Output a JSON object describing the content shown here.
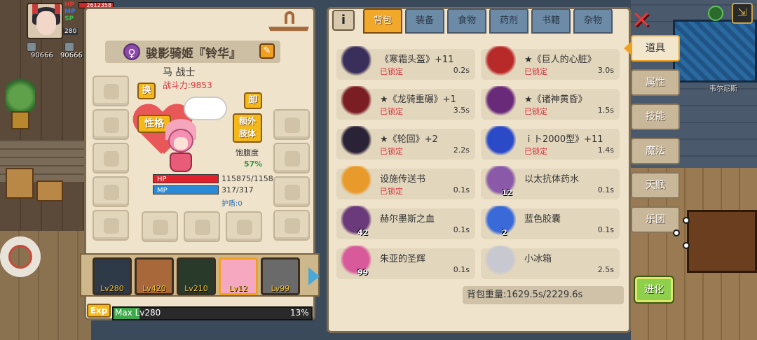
{
  "hud": {
    "hp_label": "HP",
    "mp_label": "MP",
    "sp_label": "SP",
    "hp_value": "2612358",
    "level": "280",
    "money_left": "90666",
    "money_right": "90666"
  },
  "character": {
    "gender_symbol": "♀",
    "name": "骏影骑姬『铃华』",
    "class": "马 战士",
    "power_label": "战斗力:",
    "power_value": "9853",
    "swap_btn": "换",
    "unequip_btn": "卸",
    "personality_btn": "性格",
    "extra_limb_btn": "额外\n肢体",
    "satiety_label": "饱腹度",
    "satiety_value": "57%",
    "hp_label": "HP",
    "hp_value": "115875/1158",
    "hp_fraction": 1.0,
    "mp_label": "MP",
    "mp_value": "317/317",
    "mp_fraction": 1.0,
    "shield": "护盾:0"
  },
  "party": [
    {
      "level": "Lv280",
      "color": "#2e3a48"
    },
    {
      "level": "Lv420",
      "color": "#a8683a"
    },
    {
      "level": "Lv210",
      "color": "#2a3a2a"
    },
    {
      "level": "Lv12",
      "color": "#f6a8c0"
    },
    {
      "level": "Lv99",
      "color": "#6a6a6a"
    }
  ],
  "exp": {
    "tag": "Exp",
    "text": "Max Lv280",
    "percent": "13%",
    "fraction": 0.13
  },
  "tabs": [
    {
      "label": "背包",
      "active": true
    },
    {
      "label": "装备",
      "active": false
    },
    {
      "label": "食物",
      "active": false
    },
    {
      "label": "药剂",
      "active": false
    },
    {
      "label": "书籍",
      "active": false
    },
    {
      "label": "杂物",
      "active": false
    }
  ],
  "inventory": [
    {
      "name": "《寒霜头盔》+11",
      "lock": "已锁定",
      "time": "0.2s",
      "icon": "helmet-icon",
      "color": "#3a2f5a",
      "qty": ""
    },
    {
      "name": "★《巨人的心脏》",
      "lock": "已锁定",
      "time": "3.0s",
      "icon": "heart-armor-icon",
      "color": "#b82a2a",
      "qty": ""
    },
    {
      "name": "★《龙骑重碾》+1",
      "lock": "已锁定",
      "time": "3.5s",
      "icon": "dragon-armor-icon",
      "color": "#7a1e24",
      "qty": ""
    },
    {
      "name": "★《诸神黄昏》",
      "lock": "已锁定",
      "time": "1.5s",
      "icon": "sword-icon",
      "color": "#6a2a7a",
      "qty": ""
    },
    {
      "name": "★《轮回》+2",
      "lock": "已锁定",
      "time": "2.2s",
      "icon": "gauntlet-icon",
      "color": "#2a2236",
      "qty": ""
    },
    {
      "name": "ｉト2000型》+11",
      "lock": "已锁定",
      "time": "1.4s",
      "icon": "orb-icon",
      "color": "#2a4ac8",
      "qty": ""
    },
    {
      "name": "设施传送书",
      "lock": "已锁定",
      "time": "0.1s",
      "icon": "book-icon",
      "color": "#e89a2a",
      "qty": ""
    },
    {
      "name": "以太抗体药水",
      "lock": "",
      "time": "0.1s",
      "icon": "potion-icon",
      "color": "#8a5aa8",
      "qty": "12"
    },
    {
      "name": "赫尔墨斯之血",
      "lock": "",
      "time": "0.1s",
      "icon": "blood-potion-icon",
      "color": "#6a3a7a",
      "qty": "42"
    },
    {
      "name": "蓝色胶囊",
      "lock": "",
      "time": "0.1s",
      "icon": "capsule-icon",
      "color": "#3a6ad8",
      "qty": "2"
    },
    {
      "name": "朱亚的圣辉",
      "lock": "",
      "time": "0.1s",
      "icon": "flask-icon",
      "color": "#d85a9a",
      "qty": "99"
    },
    {
      "name": "小冰箱",
      "lock": "",
      "time": "2.5s",
      "icon": "fridge-icon",
      "color": "#c8c8d0",
      "qty": ""
    }
  ],
  "weight": "背包重量:1629.5s/2229.6s",
  "side_tabs": [
    {
      "label": "道具",
      "active": true
    },
    {
      "label": "属性",
      "active": false
    },
    {
      "label": "技能",
      "active": false
    },
    {
      "label": "魔法",
      "active": false
    },
    {
      "label": "天赋",
      "active": false
    },
    {
      "label": "乐团",
      "active": false
    }
  ],
  "evolve": "进化",
  "location": "韦尔尼斯"
}
